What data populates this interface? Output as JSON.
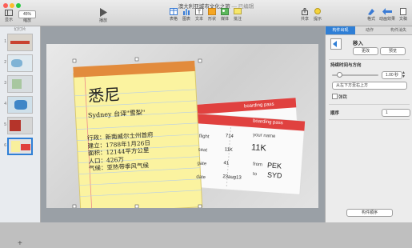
{
  "window": {
    "title": "澳大利亚城市文化之旅",
    "subtitle": "— 已编辑"
  },
  "toolbar": {
    "view_label": "显示",
    "zoom_value": "45%",
    "zoom_label": "缩放",
    "play_label": "播放",
    "table_label": "表格",
    "chart_label": "图表",
    "text_label": "文本",
    "shape_label": "形状",
    "media_label": "媒体",
    "comment_label": "批注",
    "share_label": "共享",
    "tips_label": "提示",
    "format_label": "格式",
    "animate_label": "动画效果",
    "setup_label": "文稿"
  },
  "navigator": {
    "header": "幻灯片",
    "add_icon": "plus-icon",
    "slide_numbers": [
      "1",
      "2",
      "3",
      "4",
      "5",
      "6"
    ]
  },
  "slide": {
    "title": "悉尼",
    "subtitle": "Sydney 台译\"雪梨\"",
    "lines": [
      "行政：新南威尔士州首府",
      "建立：1788年1月26日",
      "面积：12144平方公里",
      "人口：426万",
      "气候：亚热带季风气候"
    ],
    "ticket_back": {
      "header": "boarding pass"
    },
    "ticket_front": {
      "header": "boarding pass",
      "labels": [
        "flight",
        "seat",
        "gate",
        "date"
      ],
      "values": [
        "714",
        "11K",
        "41",
        "23aug13"
      ],
      "your_name": "your name",
      "name_value": "11K",
      "from_label": "from",
      "from_value": "PEK",
      "to_label": "to",
      "to_value": "SYD"
    }
  },
  "inspector": {
    "tabs": [
      "构件出现",
      "动作",
      "构件消失"
    ],
    "effect_name": "移入",
    "change_button": "更改",
    "preview_button": "预览",
    "duration_section": "持续时间与方向",
    "duration_value": "1.00 秒",
    "direction_value": "从左下方至右上方",
    "bounce_label": "弹跳",
    "order_label": "顺序",
    "order_value": "1",
    "build_order_button": "构件顺序"
  },
  "colors": {
    "accent": "#2f7fd6",
    "ticket_red": "#e0413f",
    "paper": "#fbf3a0"
  }
}
